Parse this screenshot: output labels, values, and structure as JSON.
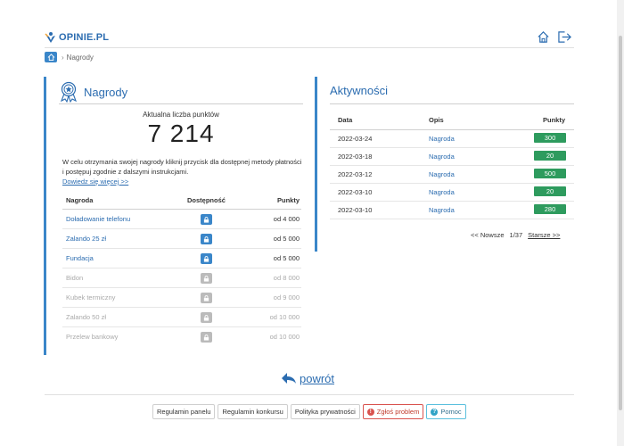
{
  "header": {
    "logo_text": "OPINIE.PL",
    "icons": [
      "home-icon",
      "logout-icon"
    ]
  },
  "breadcrumb": {
    "home_icon": "home-icon",
    "separator": "›",
    "current": "Nagrody"
  },
  "rewards_panel": {
    "title": "Nagrody",
    "title_icon": "award-medal-icon",
    "points_label": "Aktualna liczba punktów",
    "points_value": "7 214",
    "info_text": "W celu otrzymania swojej nagrody kliknij przycisk dla dostępnej metody płatności i postępuj zgodnie z dalszymi instrukcjami.",
    "more_link": "Dowiedz się więcej >>",
    "columns": [
      "Nagroda",
      "Dostępność",
      "Punkty"
    ],
    "rows": [
      {
        "name": "Doładowanie telefonu",
        "points": "od 4 000",
        "available": true
      },
      {
        "name": "Zalando 25 zł",
        "points": "od 5 000",
        "available": true
      },
      {
        "name": "Fundacja",
        "points": "od 5 000",
        "available": true
      },
      {
        "name": "Bidon",
        "points": "od 8 000",
        "available": false
      },
      {
        "name": "Kubek termiczny",
        "points": "od 9 000",
        "available": false
      },
      {
        "name": "Zalando 50 zł",
        "points": "od 10 000",
        "available": false
      },
      {
        "name": "Przelew bankowy",
        "points": "od 10 000",
        "available": false
      }
    ]
  },
  "activity_panel": {
    "title": "Aktywności",
    "columns": [
      "Data",
      "Opis",
      "Punkty"
    ],
    "rows": [
      {
        "date": "2022-03-24",
        "desc": "Nagroda",
        "points": "300"
      },
      {
        "date": "2022-03-18",
        "desc": "Nagroda",
        "points": "20"
      },
      {
        "date": "2022-03-12",
        "desc": "Nagroda",
        "points": "500"
      },
      {
        "date": "2022-03-10",
        "desc": "Nagroda",
        "points": "20"
      },
      {
        "date": "2022-03-10",
        "desc": "Nagroda",
        "points": "280"
      }
    ],
    "pager": {
      "newer": "<< Nowsze",
      "page": "1/37",
      "older": "Starsze >>"
    }
  },
  "back_link": "powrót",
  "footer": {
    "buttons": [
      "Regulamin panelu",
      "Regulamin konkursu",
      "Polityka prywatności",
      "Zgłoś problem",
      "Pomoc"
    ]
  },
  "colors": {
    "accent": "#3a86c9",
    "link": "#2b6cb0",
    "badge": "#2e9b5e",
    "locked": "#bbbbbb",
    "report": "#d9534f",
    "help": "#31a3c6"
  }
}
